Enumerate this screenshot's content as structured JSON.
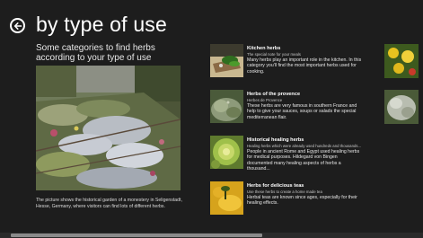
{
  "header": {
    "title": "by type of use",
    "back_icon": "back-arrow-icon"
  },
  "intro": {
    "text": "Some categories to find herbs according to your type of use"
  },
  "hero": {
    "caption": "The picture shows the historical garden of a monestery in Seligenstadt, Hesse, Germany, where visitors can find lots of different herbs."
  },
  "categories": [
    {
      "title": "Kitchen herbs",
      "subtitle": "The special note for your meals",
      "description": "Many herbs play an important role in the kitchen. In this category you'll find the most important herbs used for cooking."
    },
    {
      "title": "Herbs of the provence",
      "subtitle": "Herbes de Provence",
      "description": "These herbs are very famous in southern France and help to give your sauces, soups or salads the special mediterranean flair."
    },
    {
      "title": "Historical healing herbs",
      "subtitle": "Healing herbs which were already used hundreds and thousands...",
      "description": "People in ancient Rome and Egypt used healing herbs for medical purposes. Hildegard von Bingen documented many healing aspects of herbs a thousand..."
    },
    {
      "title": "Herbs for delicious teas",
      "subtitle": "Use these herbs to create a home made tea",
      "description": "Herbal teas are known since ages, especially for their healing effects."
    }
  ],
  "scroll": {
    "position_fraction": 0.03,
    "visible_fraction": 0.6
  }
}
